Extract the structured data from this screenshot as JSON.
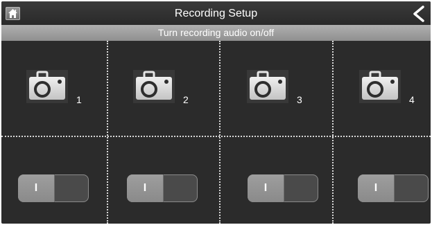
{
  "header": {
    "title": "Recording Setup",
    "home_icon": "home-icon",
    "back_icon": "chevron-left-icon"
  },
  "subheader": {
    "text": "Turn recording audio on/off"
  },
  "cameras": [
    {
      "number": "1",
      "icon": "camera-icon",
      "toggle_label": "I",
      "state": "on"
    },
    {
      "number": "2",
      "icon": "camera-icon",
      "toggle_label": "I",
      "state": "on"
    },
    {
      "number": "3",
      "icon": "camera-icon",
      "toggle_label": "I",
      "state": "on"
    },
    {
      "number": "4",
      "icon": "camera-icon",
      "toggle_label": "I",
      "state": "on"
    }
  ],
  "colors": {
    "background": "#2b2b2b",
    "subheader": "#a0a0a0",
    "toggle_knob": "#959595",
    "toggle_track": "#4a4a4a",
    "divider": "#d8d8d8"
  }
}
